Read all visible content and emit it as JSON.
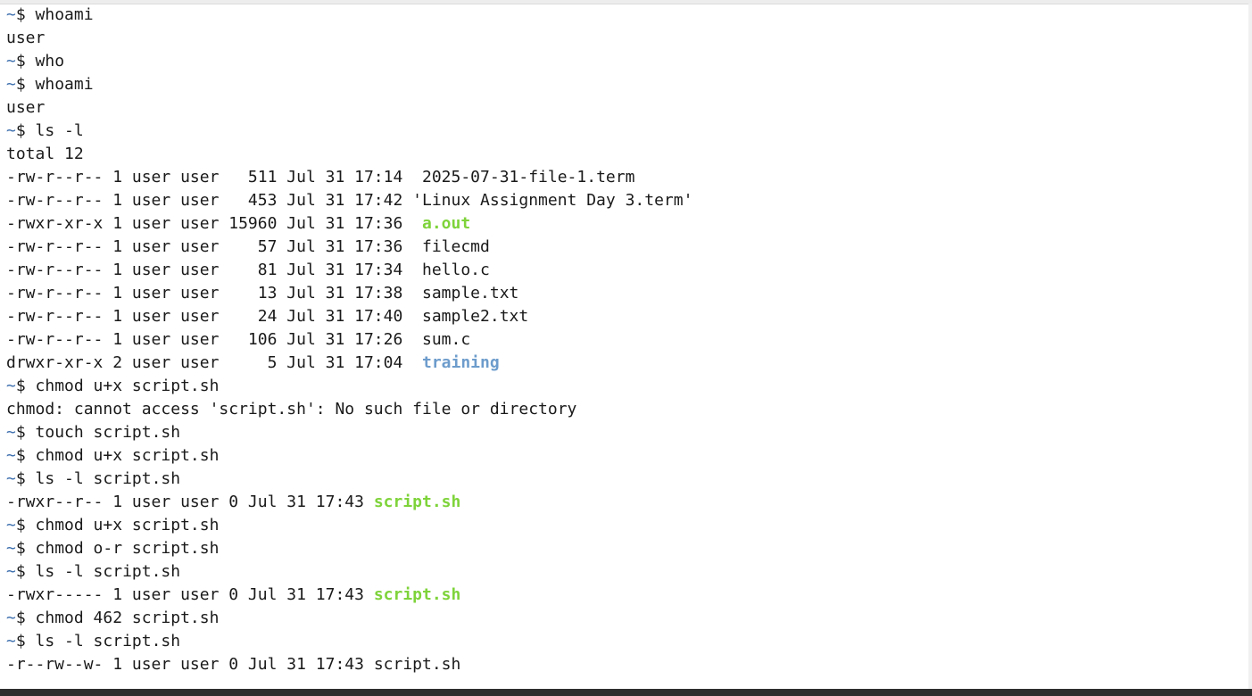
{
  "terminal": {
    "prompt_symbol": "~",
    "prompt_dollar": "$ ",
    "lines": [
      {
        "type": "cmd",
        "text": "whoami"
      },
      {
        "type": "out",
        "text": "user"
      },
      {
        "type": "cmd",
        "text": "who"
      },
      {
        "type": "cmd",
        "text": "whoami"
      },
      {
        "type": "out",
        "text": "user"
      },
      {
        "type": "cmd",
        "text": "ls -l"
      },
      {
        "type": "out",
        "text": "total 12"
      },
      {
        "type": "ls",
        "prefix": "-rw-r--r-- 1 user user   511 Jul 31 17:14  ",
        "name": "2025-07-31-file-1.term",
        "kind": "file"
      },
      {
        "type": "ls",
        "prefix": "-rw-r--r-- 1 user user   453 Jul 31 17:42 ",
        "name": "'Linux Assignment Day 3.term'",
        "kind": "file"
      },
      {
        "type": "ls",
        "prefix": "-rwxr-xr-x 1 user user 15960 Jul 31 17:36  ",
        "name": "a.out",
        "kind": "exec"
      },
      {
        "type": "ls",
        "prefix": "-rw-r--r-- 1 user user    57 Jul 31 17:36  ",
        "name": "filecmd",
        "kind": "file"
      },
      {
        "type": "ls",
        "prefix": "-rw-r--r-- 1 user user    81 Jul 31 17:34  ",
        "name": "hello.c",
        "kind": "file"
      },
      {
        "type": "ls",
        "prefix": "-rw-r--r-- 1 user user    13 Jul 31 17:38  ",
        "name": "sample.txt",
        "kind": "file"
      },
      {
        "type": "ls",
        "prefix": "-rw-r--r-- 1 user user    24 Jul 31 17:40  ",
        "name": "sample2.txt",
        "kind": "file"
      },
      {
        "type": "ls",
        "prefix": "-rw-r--r-- 1 user user   106 Jul 31 17:26  ",
        "name": "sum.c",
        "kind": "file"
      },
      {
        "type": "ls",
        "prefix": "drwxr-xr-x 2 user user     5 Jul 31 17:04  ",
        "name": "training",
        "kind": "dir"
      },
      {
        "type": "cmd",
        "text": "chmod u+x script.sh"
      },
      {
        "type": "out",
        "text": "chmod: cannot access 'script.sh': No such file or directory"
      },
      {
        "type": "cmd",
        "text": "touch script.sh"
      },
      {
        "type": "cmd",
        "text": "chmod u+x script.sh"
      },
      {
        "type": "cmd",
        "text": "ls -l script.sh"
      },
      {
        "type": "ls",
        "prefix": "-rwxr--r-- 1 user user 0 Jul 31 17:43 ",
        "name": "script.sh",
        "kind": "exec"
      },
      {
        "type": "cmd",
        "text": "chmod u+x script.sh"
      },
      {
        "type": "cmd",
        "text": "chmod o-r script.sh"
      },
      {
        "type": "cmd",
        "text": "ls -l script.sh"
      },
      {
        "type": "ls",
        "prefix": "-rwxr----- 1 user user 0 Jul 31 17:43 ",
        "name": "script.sh",
        "kind": "exec"
      },
      {
        "type": "cmd",
        "text": "chmod 462 script.sh"
      },
      {
        "type": "cmd",
        "text": "ls -l script.sh"
      },
      {
        "type": "ls",
        "prefix": "-r--rw--w- 1 user user 0 Jul 31 17:43 ",
        "name": "script.sh",
        "kind": "file"
      }
    ]
  },
  "colors": {
    "prompt": "#3d6fae",
    "executable": "#7ed33a",
    "directory": "#6d9ccc",
    "text": "#1a1a1a",
    "background": "#ffffff"
  }
}
